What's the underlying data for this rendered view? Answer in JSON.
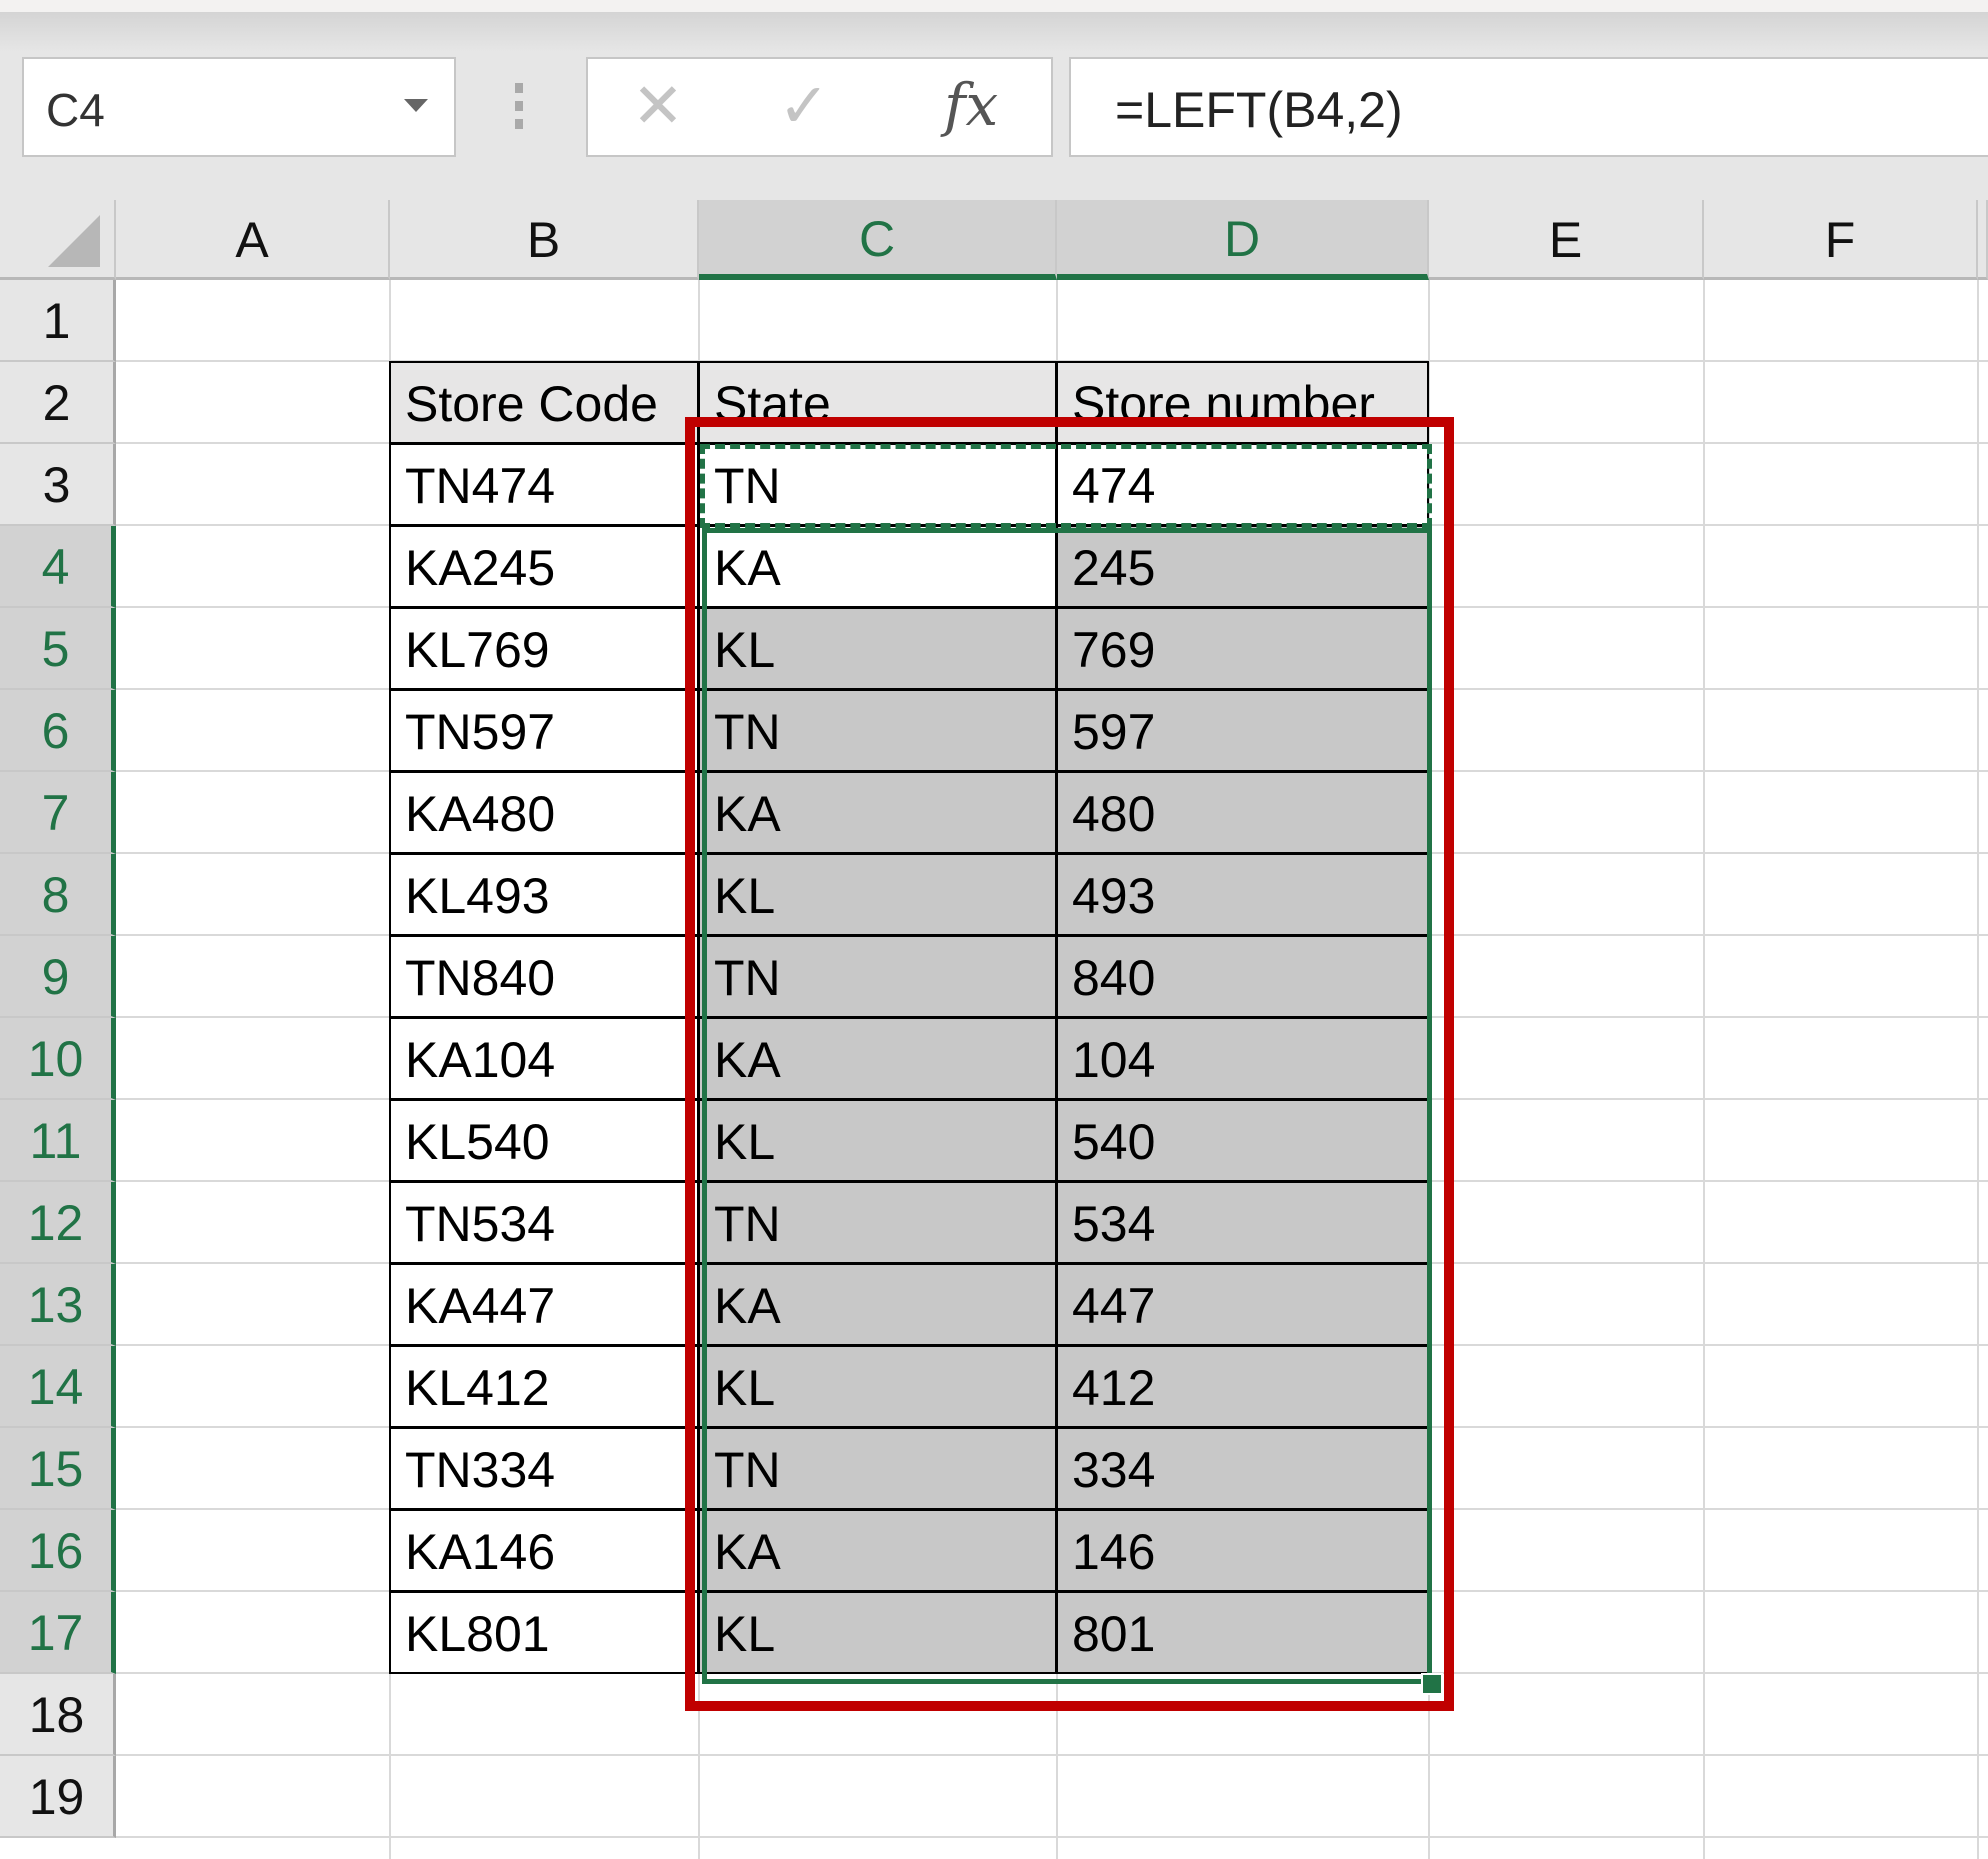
{
  "formula_bar": {
    "name_box": "C4",
    "cancel_icon": "✕",
    "enter_icon": "✓",
    "fx_label": "fx",
    "formula": "=LEFT(B4,2)"
  },
  "columns": [
    "A",
    "B",
    "C",
    "D",
    "E",
    "F"
  ],
  "selected_columns": [
    "C",
    "D"
  ],
  "rows": [
    "1",
    "2",
    "3",
    "4",
    "5",
    "6",
    "7",
    "8",
    "9",
    "10",
    "11",
    "12",
    "13",
    "14",
    "15",
    "16",
    "17",
    "18",
    "19"
  ],
  "selected_rows": [
    "4",
    "5",
    "6",
    "7",
    "8",
    "9",
    "10",
    "11",
    "12",
    "13",
    "14",
    "15",
    "16",
    "17"
  ],
  "table": {
    "headers": [
      "Store Code",
      "State",
      "Store number"
    ],
    "rows": [
      [
        "TN474",
        "TN",
        "474"
      ],
      [
        "KA245",
        "KA",
        "245"
      ],
      [
        "KL769",
        "KL",
        "769"
      ],
      [
        "TN597",
        "TN",
        "597"
      ],
      [
        "KA480",
        "KA",
        "480"
      ],
      [
        "KL493",
        "KL",
        "493"
      ],
      [
        "TN840",
        "TN",
        "840"
      ],
      [
        "KA104",
        "KA",
        "104"
      ],
      [
        "KL540",
        "KL",
        "540"
      ],
      [
        "TN534",
        "TN",
        "534"
      ],
      [
        "KA447",
        "KA",
        "447"
      ],
      [
        "KL412",
        "KL",
        "412"
      ],
      [
        "TN334",
        "TN",
        "334"
      ],
      [
        "KA146",
        "KA",
        "146"
      ],
      [
        "KL801",
        "KL",
        "801"
      ]
    ]
  },
  "colors": {
    "selection_green": "#217346",
    "highlight_red": "#c00000",
    "selected_fill": "#c8c8c8",
    "header_fill": "#e7e6e6"
  }
}
